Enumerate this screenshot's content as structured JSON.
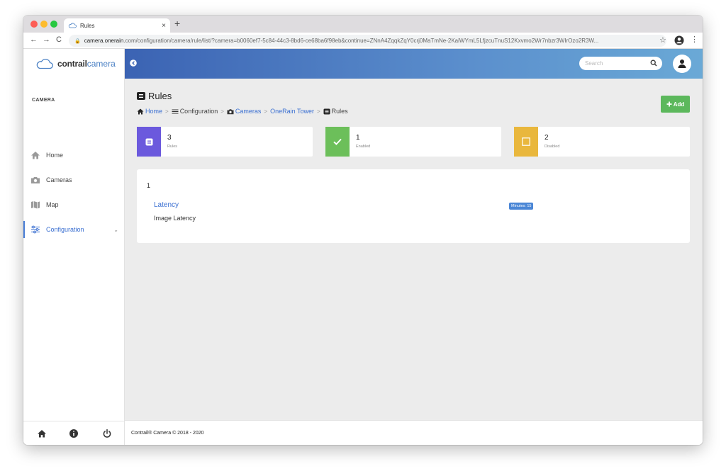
{
  "browser": {
    "tab_title": "Rules",
    "tab_close": "×",
    "new_tab": "+",
    "back": "←",
    "forward": "→",
    "reload": "C",
    "url_host": "camera.onerain",
    "url_rest": ".com/configuration/camera/rule/list/?camera=b0060ef7-5c84-44c3-8bd6-ce68ba6f98eb&continue=ZNnA4ZqqkZqY0crj0MaTmNe-2KaiWYmL5LfjzcuTnuS12Kxvmo2Wr7nbzr3WIrOzo2R3W...",
    "star": "☆",
    "menu": "⋮"
  },
  "sidebar": {
    "brand_bold": "contrail",
    "brand_light": "camera",
    "section_label": "CAMERA",
    "items": [
      {
        "label": "Home",
        "icon": "home-icon"
      },
      {
        "label": "Cameras",
        "icon": "camera-icon"
      },
      {
        "label": "Map",
        "icon": "map-icon"
      },
      {
        "label": "Configuration",
        "icon": "sliders-icon",
        "active": true,
        "chevron": "⌄"
      }
    ]
  },
  "topbar": {
    "search_placeholder": "Search"
  },
  "page": {
    "title": "Rules",
    "breadcrumb": {
      "home": "Home",
      "configuration": "Configuration",
      "cameras": "Cameras",
      "tower": "OneRain Tower",
      "rules": "Rules",
      "sep": ">"
    },
    "add_label": "Add"
  },
  "stats": [
    {
      "value": "3",
      "label": "Rules",
      "color": "#6b59dd"
    },
    {
      "value": "1",
      "label": "Enabled",
      "color": "#6cbf5a"
    },
    {
      "value": "2",
      "label": "Disabled",
      "color": "#e9b73d"
    }
  ],
  "rules": {
    "count": "1",
    "items": [
      {
        "name": "Latency",
        "description": "Image Latency",
        "badge": "Minutes: 15"
      }
    ]
  },
  "footer": {
    "text": "Contrail® Camera © 2018 - 2020"
  }
}
